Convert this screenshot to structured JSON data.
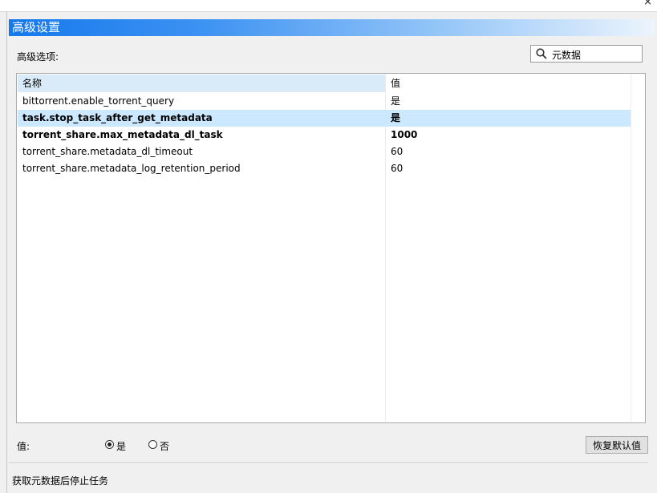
{
  "window": {
    "close_glyph": "×"
  },
  "title": "高级设置",
  "section_label": "高级选项:",
  "search": {
    "value": "元数据",
    "icon": "search-icon"
  },
  "table": {
    "columns": [
      "名称",
      "值"
    ],
    "rows": [
      {
        "name": "bittorrent.enable_torrent_query",
        "value": "是"
      },
      {
        "name": "task.stop_task_after_get_metadata",
        "value": "是"
      },
      {
        "name": "torrent_share.max_metadata_dl_task",
        "value": "1000"
      },
      {
        "name": "torrent_share.metadata_dl_timeout",
        "value": "60"
      },
      {
        "name": "torrent_share.metadata_log_retention_period",
        "value": "60"
      }
    ]
  },
  "value_editor": {
    "label": "值:",
    "options": [
      {
        "label": "是",
        "selected": true
      },
      {
        "label": "否",
        "selected": false
      }
    ],
    "reset_label": "恢复默认值"
  },
  "description": "获取元数据后停止任务",
  "colors": {
    "accent": "#1579ec",
    "selection": "#cce8ff",
    "header_bg": "#d9eaf8"
  }
}
